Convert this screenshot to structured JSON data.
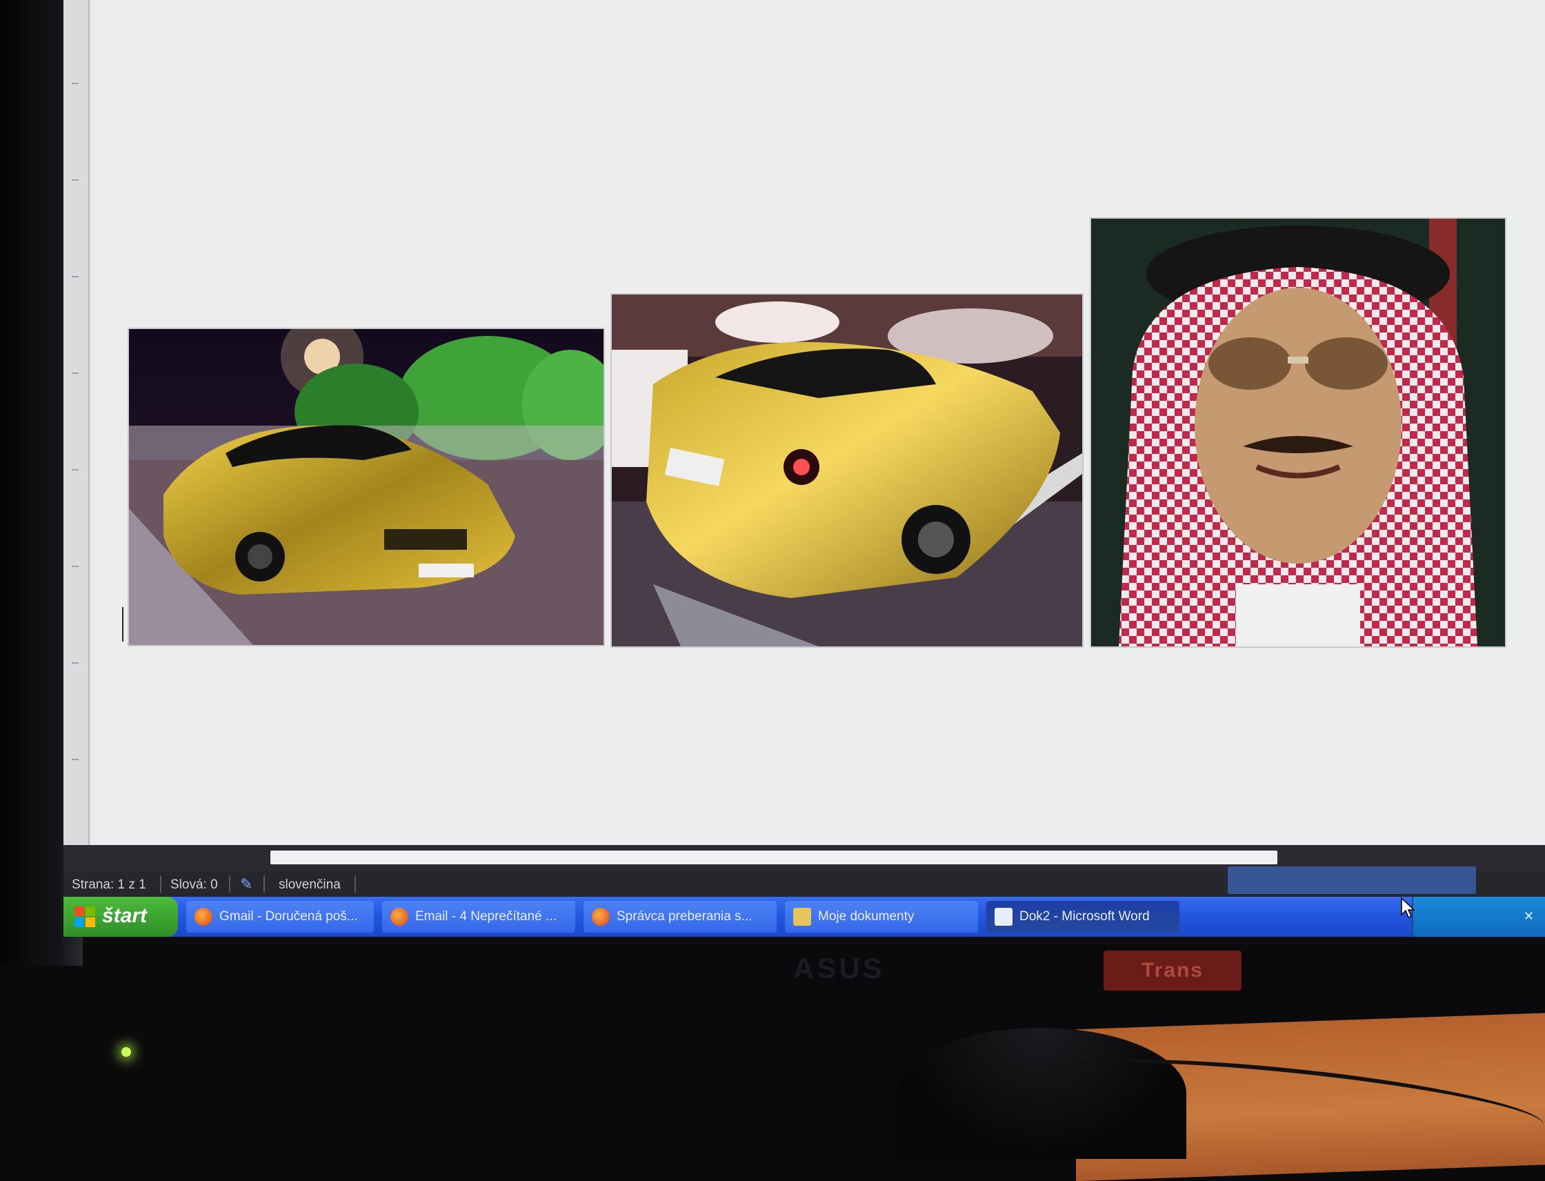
{
  "document": {
    "images": [
      {
        "name": "gold-car-front-photo"
      },
      {
        "name": "gold-car-rear-photo"
      },
      {
        "name": "man-in-keffiyeh-photo"
      }
    ]
  },
  "statusbar": {
    "page": "Strana: 1 z 1",
    "words": "Slová: 0",
    "language": "slovenčina"
  },
  "taskbar": {
    "start_label": "štart",
    "tasks": [
      {
        "label": "Gmail - Doručená poš...",
        "icon": "firefox-icon",
        "active": false
      },
      {
        "label": "Email - 4 Neprečítané ...",
        "icon": "firefox-icon",
        "active": false
      },
      {
        "label": "Správca preberania s...",
        "icon": "firefox-icon",
        "active": false
      },
      {
        "label": "Moje dokumenty",
        "icon": "folder-icon",
        "active": false
      },
      {
        "label": "Dok2 - Microsoft Word",
        "icon": "word-icon",
        "active": true
      }
    ]
  },
  "monitor": {
    "brand": "ASUS",
    "badge": "Trans"
  },
  "colors": {
    "taskbar": "#2456e0",
    "start": "#3aa22e",
    "document_bg": "#eceeee"
  }
}
